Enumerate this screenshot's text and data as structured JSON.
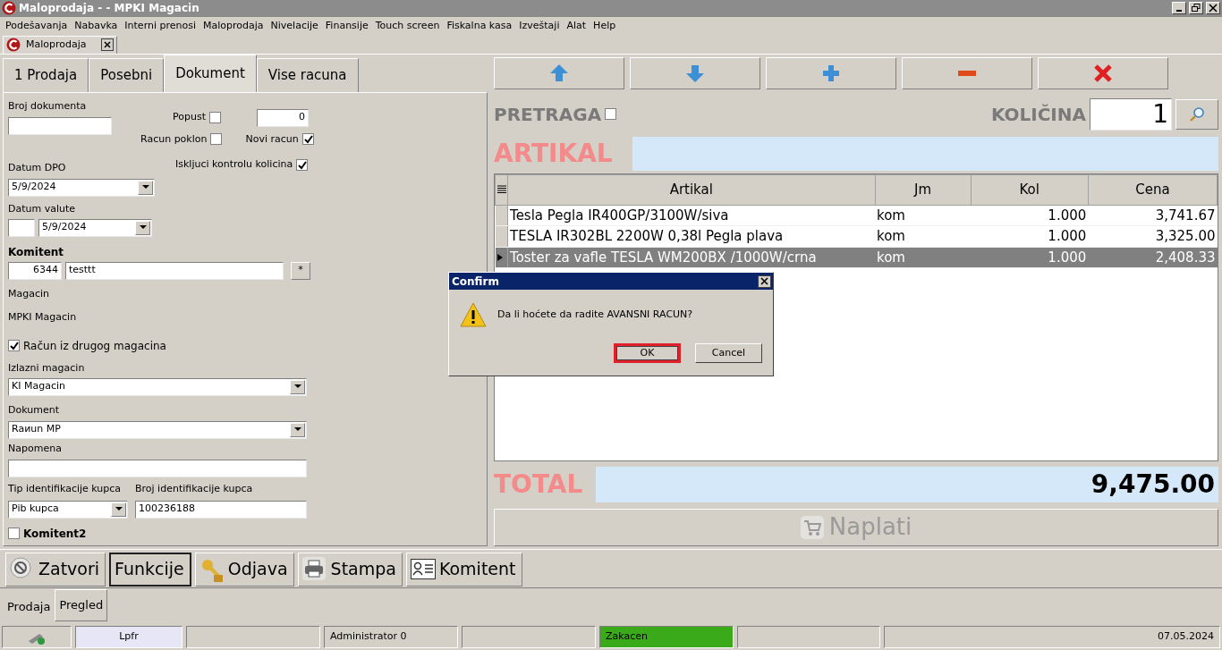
{
  "window": {
    "title": "Maloprodaja -  - MPKI Magacin"
  },
  "menu": [
    "Podešavanja",
    "Nabavka",
    "Interni prenosi",
    "Maloprodaja",
    "Nivelacije",
    "Finansije",
    "Touch screen",
    "Fiskalna kasa",
    "Izveštaji",
    "Alat",
    "Help"
  ],
  "document_tabs": [
    {
      "label": "Maloprodaja",
      "selected": true
    }
  ],
  "left_tabs": [
    {
      "label": "1 Prodaja",
      "selected": false
    },
    {
      "label": "Posebni",
      "selected": false
    },
    {
      "label": "Dokument",
      "selected": true
    },
    {
      "label": "Vise racuna",
      "selected": false
    }
  ],
  "form": {
    "broj_dokumenta": {
      "label": "Broj dokumenta"
    },
    "popust": {
      "label": "Popust",
      "checked": false,
      "value": "0"
    },
    "racun_poklon": {
      "label": "Racun poklon",
      "checked": false
    },
    "novi_racun": {
      "label": "Novi racun",
      "checked": true
    },
    "iskljuci_kontrolu": {
      "label": "Iskljuci kontrolu kolicina",
      "checked": true
    },
    "datum_dpo": {
      "label": "Datum DPO",
      "value": "5/9/2024"
    },
    "datum_valute": {
      "label": "Datum valute",
      "value": "5/9/2024"
    },
    "komitent": {
      "label": "Komitent",
      "code": "6344",
      "name": "testtt",
      "button": "*"
    },
    "magacin": {
      "label": "Magacin",
      "value": "MPKI Magacin"
    },
    "racun_iz_drugog": {
      "label": "Račun iz drugog magacina",
      "checked": true
    },
    "izlazni_magacin": {
      "label": "Izlazni magacin",
      "value": "KI Magacin"
    },
    "dokument": {
      "label": "Dokument",
      "value": "Raиun MP"
    },
    "napomena": {
      "label": "Napomena"
    },
    "tip_identifikacije": {
      "label": "Tip identifikacije kupca",
      "value": "Pib kupca"
    },
    "broj_identifikacije": {
      "label": "Broj identifikacije kupca",
      "value": "100236188"
    },
    "komitent2": {
      "label": "Komitent2",
      "checked": false
    }
  },
  "pretraga": {
    "label": "PRETRAGA",
    "checked": false
  },
  "kolicina": {
    "label": "KOLIČINA",
    "value": "1"
  },
  "artikal": {
    "label": "ARTIKAL"
  },
  "table": {
    "columns": [
      "Artikal",
      "Jm",
      "Kol",
      "Cena"
    ],
    "rows": [
      {
        "cells": [
          "Tesla Pegla IR400GP/3100W/siva",
          "kom",
          "1.000",
          "3,741.67"
        ],
        "selected": false
      },
      {
        "cells": [
          "TESLA IR302BL 2200W 0,38l Pegla plava",
          "kom",
          "1.000",
          "3,325.00"
        ],
        "selected": false
      },
      {
        "cells": [
          "Toster za vafle TESLA WM200BX /1000W/crna",
          "kom",
          "1.000",
          "2,408.33"
        ],
        "selected": true
      }
    ]
  },
  "total": {
    "label": "TOTAL",
    "value": "9,475.00"
  },
  "pay_button": {
    "label": "Naplati",
    "disabled": true
  },
  "bottom_buttons": [
    {
      "label": "Zatvori",
      "kind": "close",
      "focused": false
    },
    {
      "label": "Funkcije",
      "kind": "plain",
      "focused": true
    },
    {
      "label": "Odjava",
      "kind": "logout",
      "focused": false
    },
    {
      "label": "Stampa",
      "kind": "print",
      "focused": false
    },
    {
      "label": "Komitent",
      "kind": "contact",
      "focused": false
    }
  ],
  "bottom_tabs": [
    {
      "label": "Prodaja",
      "selected": true
    },
    {
      "label": "Pregled",
      "selected": false
    }
  ],
  "status_bar": [
    {
      "kind": "icon"
    },
    {
      "kind": "text",
      "text": "Lpfr",
      "color": "#e6e6f7"
    },
    {
      "kind": "empty"
    },
    {
      "kind": "text",
      "text": "Administrator 0"
    },
    {
      "kind": "empty"
    },
    {
      "kind": "text",
      "text": "Zakacen",
      "color": "#3aaa1a"
    },
    {
      "kind": "empty"
    },
    {
      "kind": "date",
      "text": "07.05.2024"
    }
  ],
  "dialog": {
    "title": "Confirm",
    "message": "Da li hoćete da radite AVANSNI RACUN?",
    "buttons": [
      {
        "label": "OK",
        "selected": true
      },
      {
        "label": "Cancel",
        "selected": false
      }
    ]
  }
}
